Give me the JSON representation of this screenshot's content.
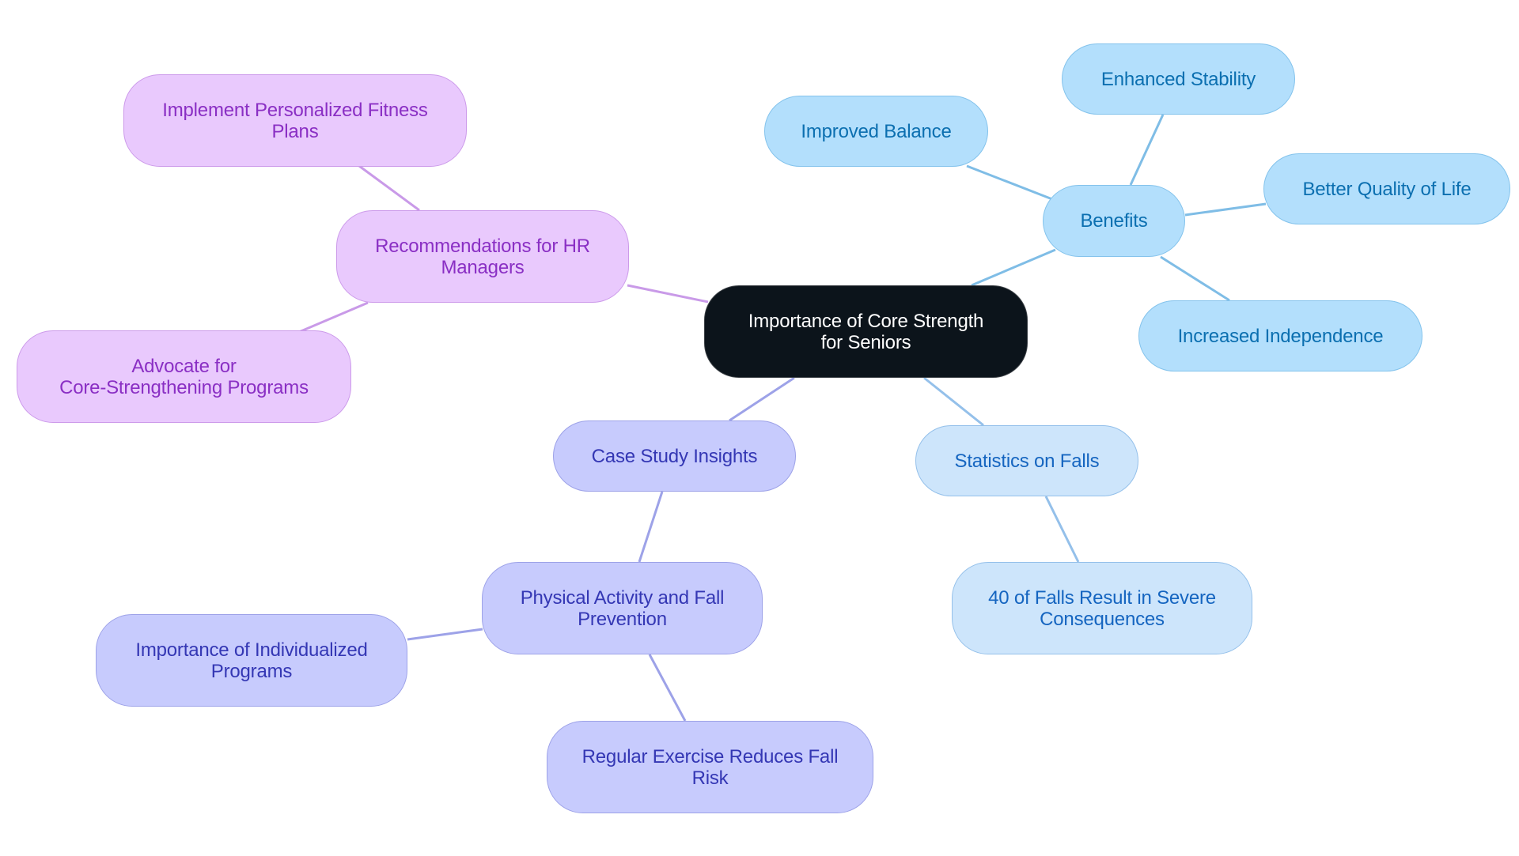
{
  "diagram": {
    "type": "mindmap",
    "root": {
      "id": "root",
      "label": "Importance of Core Strength\nfor Seniors"
    },
    "nodes": [
      {
        "id": "benefits",
        "label": "Benefits",
        "parent": "root",
        "style": "blue"
      },
      {
        "id": "improved-balance",
        "label": "Improved Balance",
        "parent": "benefits",
        "style": "blue"
      },
      {
        "id": "enhanced-stability",
        "label": "Enhanced Stability",
        "parent": "benefits",
        "style": "blue"
      },
      {
        "id": "better-quality-of-life",
        "label": "Better Quality of Life",
        "parent": "benefits",
        "style": "blue"
      },
      {
        "id": "increased-independence",
        "label": "Increased Independence",
        "parent": "benefits",
        "style": "blue"
      },
      {
        "id": "statistics-on-falls",
        "label": "Statistics on Falls",
        "parent": "root",
        "style": "lblue"
      },
      {
        "id": "falls-severe",
        "label": "40 of Falls Result in Severe\nConsequences",
        "parent": "statistics-on-falls",
        "style": "lblue"
      },
      {
        "id": "recommendations",
        "label": "Recommendations for HR\nManagers",
        "parent": "root",
        "style": "purple"
      },
      {
        "id": "implement-plans",
        "label": "Implement Personalized Fitness\nPlans",
        "parent": "recommendations",
        "style": "purple"
      },
      {
        "id": "advocate-programs",
        "label": "Advocate for\nCore-Strengthening Programs",
        "parent": "recommendations",
        "style": "purple"
      },
      {
        "id": "case-study",
        "label": "Case Study Insights",
        "parent": "root",
        "style": "indigo"
      },
      {
        "id": "physical-activity",
        "label": "Physical Activity and Fall\nPrevention",
        "parent": "case-study",
        "style": "indigo"
      },
      {
        "id": "individualized-programs",
        "label": "Importance of Individualized\nPrograms",
        "parent": "physical-activity",
        "style": "indigo"
      },
      {
        "id": "regular-exercise",
        "label": "Regular Exercise Reduces Fall\nRisk",
        "parent": "physical-activity",
        "style": "indigo"
      }
    ],
    "colors": {
      "root_fill": "#0c141b",
      "root_text": "#ffffff",
      "blue_edge": "#7fbde6",
      "lblue_edge": "#94c0ea",
      "purple_edge": "#c99ae8",
      "indigo_edge": "#9da2e8"
    }
  }
}
